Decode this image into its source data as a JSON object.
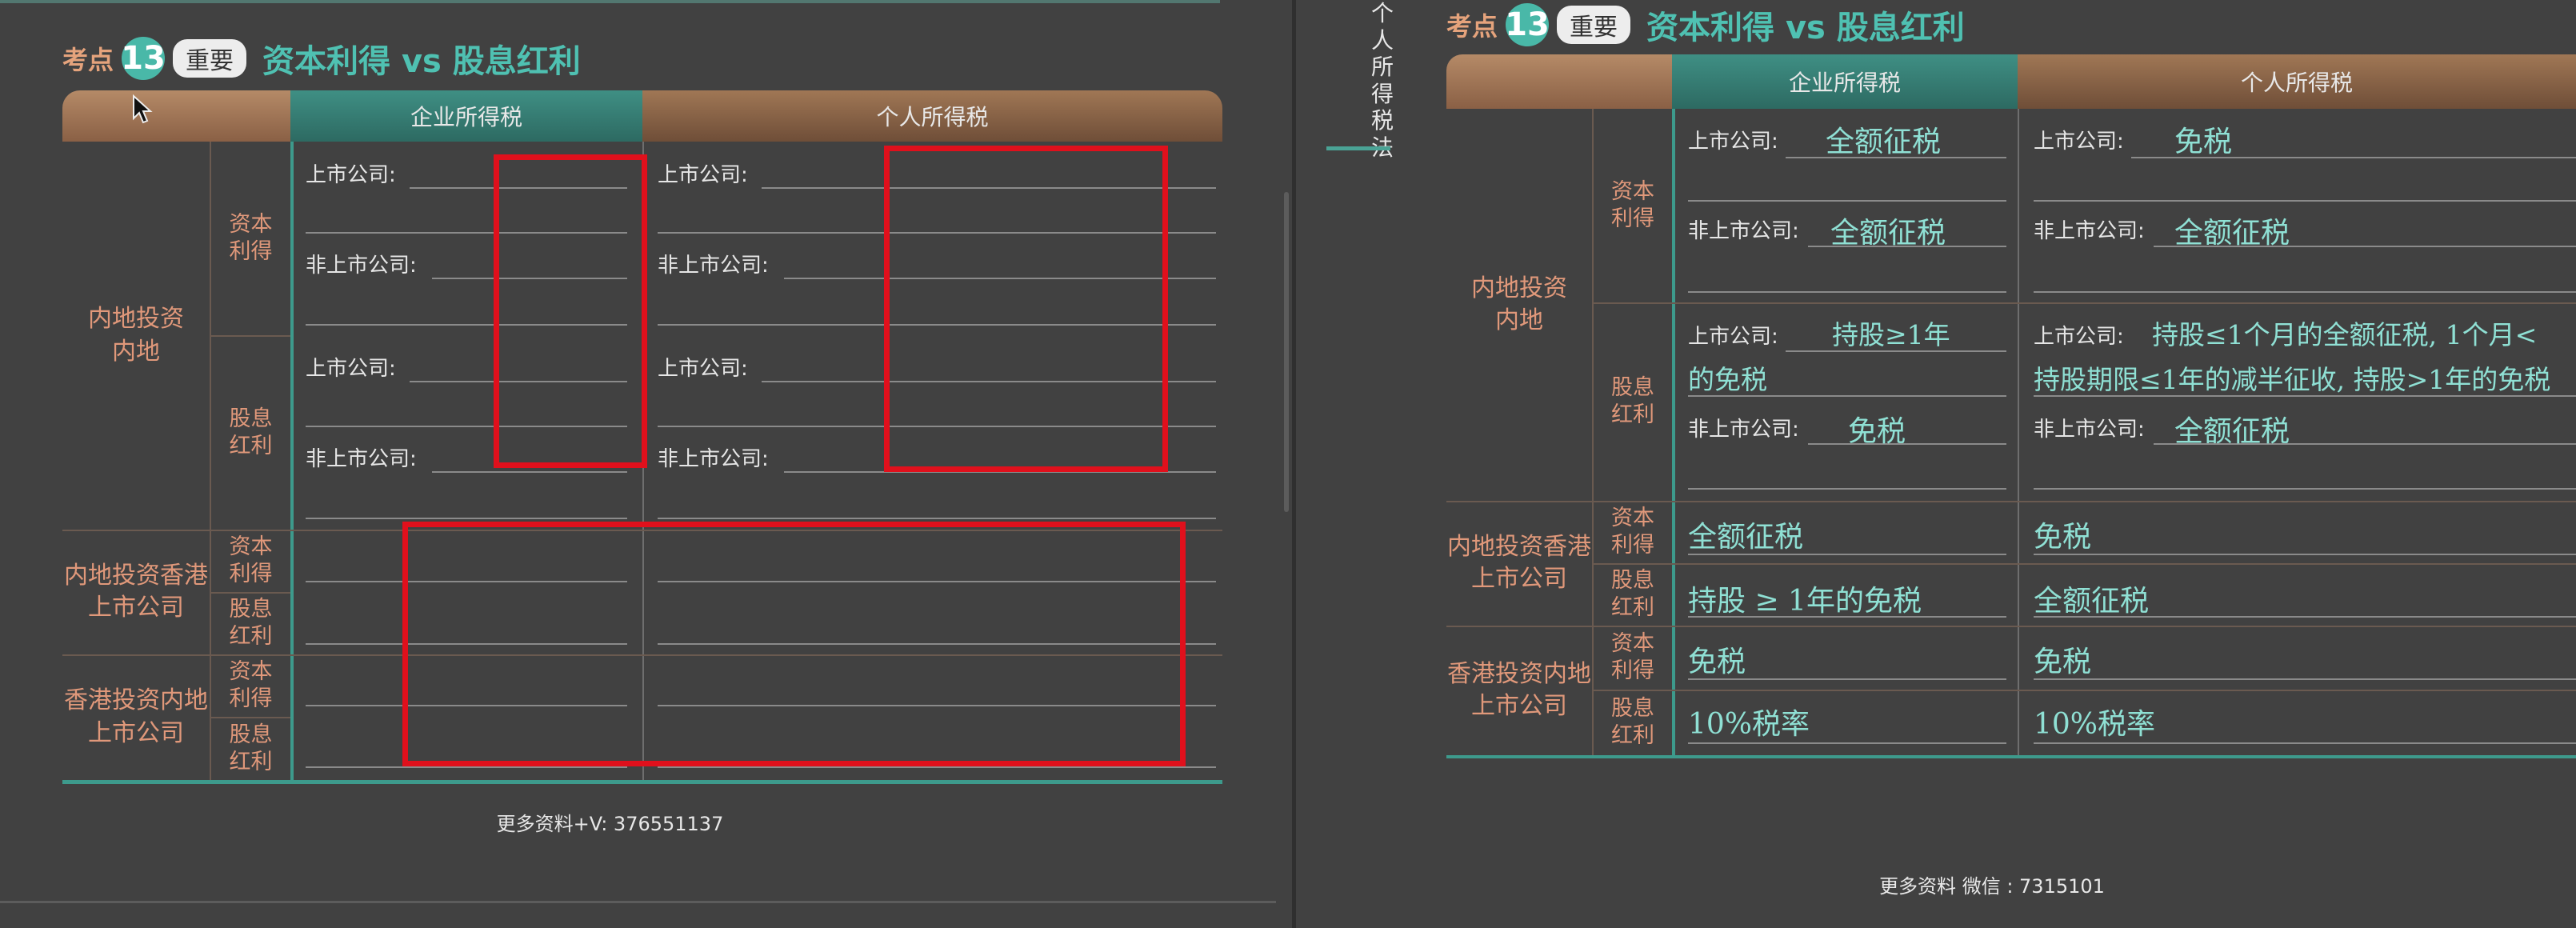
{
  "left": {
    "badge": {
      "prefix": "考点",
      "number": "13",
      "importance": "重要",
      "title": "资本利得 vs 股息红利"
    },
    "col_headers": [
      "企业所得税",
      "个人所得税"
    ],
    "groups": [
      "内地投资内地",
      "内地投资香港上市公司",
      "香港投资内地上市公司"
    ],
    "sub_labels": {
      "capital": "资本利得",
      "dividend": "股息红利"
    },
    "company_labels": {
      "listed": "上市公司:",
      "unlisted": "非上市公司:"
    },
    "footer": "更多资料+V:  376551137"
  },
  "right": {
    "side_tab": "个人所得税法",
    "badge": {
      "prefix": "考点",
      "number": "13",
      "importance": "重要",
      "title": "资本利得 vs 股息红利"
    },
    "col_headers": [
      "企业所得税",
      "个人所得税"
    ],
    "groups": [
      "内地投资内地",
      "内地投资香港上市公司",
      "香港投资内地上市公司"
    ],
    "sub_labels": {
      "capital": "资本利得",
      "dividend": "股息红利"
    },
    "company_labels": {
      "listed": "上市公司:",
      "unlisted": "非上市公司:"
    },
    "answers": {
      "corp_cap_listed": "全额征税",
      "corp_cap_unlisted": "全额征税",
      "corp_div_listed_1": "持股≥1年",
      "corp_div_listed_2": "的免税",
      "corp_div_unlisted": "免税",
      "ind_cap_listed": "免税",
      "ind_cap_unlisted": "全额征税",
      "ind_div_listed_1": "持股≤1个月的全额征税, 1个月<",
      "ind_div_listed_2": "持股期限≤1年的减半征收, 持股>1年的免税",
      "ind_div_unlisted": "全额征税",
      "hk_corp_cap": "全额征税",
      "hk_ind_cap": "免税",
      "hk_corp_div": "持股 ≥ 1年的免税",
      "hk_ind_div": "全额征税",
      "mk_corp_cap": "免税",
      "mk_ind_cap": "免税",
      "mk_corp_div": "10%税率",
      "mk_ind_div": "10%税率"
    },
    "footer": "更多资料  微信 :  7315101"
  }
}
